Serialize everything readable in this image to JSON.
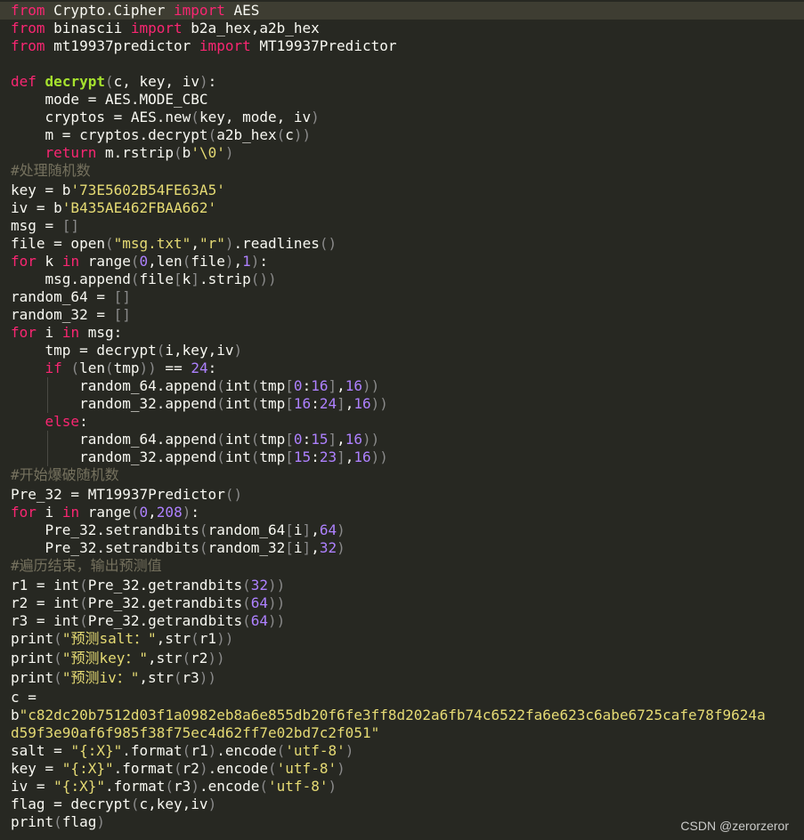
{
  "editor": {
    "lines": [
      [
        [
          "kw",
          "from"
        ],
        [
          "plain",
          " Crypto.Cipher "
        ],
        [
          "kw",
          "import"
        ],
        [
          "plain",
          " AES"
        ]
      ],
      [
        [
          "kw",
          "from"
        ],
        [
          "plain",
          " binascii "
        ],
        [
          "kw",
          "import"
        ],
        [
          "plain",
          " b2a_hex,a2b_hex"
        ]
      ],
      [
        [
          "kw",
          "from"
        ],
        [
          "plain",
          " mt19937predictor "
        ],
        [
          "kw",
          "import"
        ],
        [
          "plain",
          " MT19937Predictor"
        ]
      ],
      [],
      [
        [
          "kw",
          "def"
        ],
        [
          "plain",
          " "
        ],
        [
          "fn",
          "decrypt"
        ],
        [
          "br",
          "("
        ],
        [
          "plain",
          "c, key, iv"
        ],
        [
          "br",
          ")"
        ],
        [
          "plain",
          ":"
        ]
      ],
      [
        [
          "plain",
          "    mode = AES.MODE_CBC"
        ]
      ],
      [
        [
          "plain",
          "    cryptos = AES.new"
        ],
        [
          "br",
          "("
        ],
        [
          "plain",
          "key, mode, iv"
        ],
        [
          "br",
          ")"
        ]
      ],
      [
        [
          "plain",
          "    m = cryptos.decrypt"
        ],
        [
          "br",
          "("
        ],
        [
          "plain",
          "a2b_hex"
        ],
        [
          "br",
          "("
        ],
        [
          "plain",
          "c"
        ],
        [
          "br",
          "))"
        ]
      ],
      [
        [
          "plain",
          "    "
        ],
        [
          "kw",
          "return"
        ],
        [
          "plain",
          " m.rstrip"
        ],
        [
          "br",
          "("
        ],
        [
          "plain",
          "b"
        ],
        [
          "str",
          "'\\0'"
        ],
        [
          "br",
          ")"
        ]
      ],
      [
        [
          "cmt",
          "#处理随机数"
        ]
      ],
      [
        [
          "plain",
          "key = b"
        ],
        [
          "str",
          "'73E5602B54FE63A5'"
        ]
      ],
      [
        [
          "plain",
          "iv = b"
        ],
        [
          "str",
          "'B435AE462FBAA662'"
        ]
      ],
      [
        [
          "plain",
          "msg = "
        ],
        [
          "br",
          "[]"
        ]
      ],
      [
        [
          "plain",
          "file = open"
        ],
        [
          "br",
          "("
        ],
        [
          "str",
          "\"msg.txt\""
        ],
        [
          "plain",
          ","
        ],
        [
          "str",
          "\"r\""
        ],
        [
          "br",
          ")"
        ],
        [
          "plain",
          ".readlines"
        ],
        [
          "br",
          "()"
        ]
      ],
      [
        [
          "kw",
          "for"
        ],
        [
          "plain",
          " k "
        ],
        [
          "kw",
          "in"
        ],
        [
          "plain",
          " range"
        ],
        [
          "br",
          "("
        ],
        [
          "num",
          "0"
        ],
        [
          "plain",
          ",len"
        ],
        [
          "br",
          "("
        ],
        [
          "plain",
          "file"
        ],
        [
          "br",
          ")"
        ],
        [
          "plain",
          ","
        ],
        [
          "num",
          "1"
        ],
        [
          "br",
          ")"
        ],
        [
          "plain",
          ":"
        ]
      ],
      [
        [
          "plain",
          "    msg.append"
        ],
        [
          "br",
          "("
        ],
        [
          "plain",
          "file"
        ],
        [
          "br",
          "["
        ],
        [
          "plain",
          "k"
        ],
        [
          "br",
          "]"
        ],
        [
          "plain",
          ".strip"
        ],
        [
          "br",
          "())"
        ]
      ],
      [
        [
          "plain",
          "random_64 = "
        ],
        [
          "br",
          "[]"
        ]
      ],
      [
        [
          "plain",
          "random_32 = "
        ],
        [
          "br",
          "[]"
        ]
      ],
      [
        [
          "kw",
          "for"
        ],
        [
          "plain",
          " i "
        ],
        [
          "kw",
          "in"
        ],
        [
          "plain",
          " msg:"
        ]
      ],
      [
        [
          "plain",
          "    tmp = decrypt"
        ],
        [
          "br",
          "("
        ],
        [
          "plain",
          "i,key,iv"
        ],
        [
          "br",
          ")"
        ]
      ],
      [
        [
          "plain",
          "    "
        ],
        [
          "kw",
          "if"
        ],
        [
          "plain",
          " "
        ],
        [
          "br",
          "("
        ],
        [
          "plain",
          "len"
        ],
        [
          "br",
          "("
        ],
        [
          "plain",
          "tmp"
        ],
        [
          "br",
          "))"
        ],
        [
          "plain",
          " == "
        ],
        [
          "num",
          "24"
        ],
        [
          "plain",
          ":"
        ]
      ],
      [
        [
          "plain",
          "        random_64.append"
        ],
        [
          "br",
          "("
        ],
        [
          "plain",
          "int"
        ],
        [
          "br",
          "("
        ],
        [
          "plain",
          "tmp"
        ],
        [
          "br",
          "["
        ],
        [
          "num",
          "0"
        ],
        [
          "plain",
          ":"
        ],
        [
          "num",
          "16"
        ],
        [
          "br",
          "]"
        ],
        [
          "plain",
          ","
        ],
        [
          "num",
          "16"
        ],
        [
          "br",
          "))"
        ]
      ],
      [
        [
          "plain",
          "        random_32.append"
        ],
        [
          "br",
          "("
        ],
        [
          "plain",
          "int"
        ],
        [
          "br",
          "("
        ],
        [
          "plain",
          "tmp"
        ],
        [
          "br",
          "["
        ],
        [
          "num",
          "16"
        ],
        [
          "plain",
          ":"
        ],
        [
          "num",
          "24"
        ],
        [
          "br",
          "]"
        ],
        [
          "plain",
          ","
        ],
        [
          "num",
          "16"
        ],
        [
          "br",
          "))"
        ]
      ],
      [
        [
          "plain",
          "    "
        ],
        [
          "kw",
          "else"
        ],
        [
          "plain",
          ":"
        ]
      ],
      [
        [
          "plain",
          "        random_64.append"
        ],
        [
          "br",
          "("
        ],
        [
          "plain",
          "int"
        ],
        [
          "br",
          "("
        ],
        [
          "plain",
          "tmp"
        ],
        [
          "br",
          "["
        ],
        [
          "num",
          "0"
        ],
        [
          "plain",
          ":"
        ],
        [
          "num",
          "15"
        ],
        [
          "br",
          "]"
        ],
        [
          "plain",
          ","
        ],
        [
          "num",
          "16"
        ],
        [
          "br",
          "))"
        ]
      ],
      [
        [
          "plain",
          "        random_32.append"
        ],
        [
          "br",
          "("
        ],
        [
          "plain",
          "int"
        ],
        [
          "br",
          "("
        ],
        [
          "plain",
          "tmp"
        ],
        [
          "br",
          "["
        ],
        [
          "num",
          "15"
        ],
        [
          "plain",
          ":"
        ],
        [
          "num",
          "23"
        ],
        [
          "br",
          "]"
        ],
        [
          "plain",
          ","
        ],
        [
          "num",
          "16"
        ],
        [
          "br",
          "))"
        ]
      ],
      [
        [
          "cmt",
          "#开始爆破随机数"
        ]
      ],
      [
        [
          "plain",
          "Pre_32 = MT19937Predictor"
        ],
        [
          "br",
          "()"
        ]
      ],
      [
        [
          "kw",
          "for"
        ],
        [
          "plain",
          " i "
        ],
        [
          "kw",
          "in"
        ],
        [
          "plain",
          " range"
        ],
        [
          "br",
          "("
        ],
        [
          "num",
          "0"
        ],
        [
          "plain",
          ","
        ],
        [
          "num",
          "208"
        ],
        [
          "br",
          ")"
        ],
        [
          "plain",
          ":"
        ]
      ],
      [
        [
          "plain",
          "    Pre_32.setrandbits"
        ],
        [
          "br",
          "("
        ],
        [
          "plain",
          "random_64"
        ],
        [
          "br",
          "["
        ],
        [
          "plain",
          "i"
        ],
        [
          "br",
          "]"
        ],
        [
          "plain",
          ","
        ],
        [
          "num",
          "64"
        ],
        [
          "br",
          ")"
        ]
      ],
      [
        [
          "plain",
          "    Pre_32.setrandbits"
        ],
        [
          "br",
          "("
        ],
        [
          "plain",
          "random_32"
        ],
        [
          "br",
          "["
        ],
        [
          "plain",
          "i"
        ],
        [
          "br",
          "]"
        ],
        [
          "plain",
          ","
        ],
        [
          "num",
          "32"
        ],
        [
          "br",
          ")"
        ]
      ],
      [
        [
          "cmt",
          "#遍历结束，输出预测值"
        ]
      ],
      [
        [
          "plain",
          "r1 = int"
        ],
        [
          "br",
          "("
        ],
        [
          "plain",
          "Pre_32.getrandbits"
        ],
        [
          "br",
          "("
        ],
        [
          "num",
          "32"
        ],
        [
          "br",
          "))"
        ]
      ],
      [
        [
          "plain",
          "r2 = int"
        ],
        [
          "br",
          "("
        ],
        [
          "plain",
          "Pre_32.getrandbits"
        ],
        [
          "br",
          "("
        ],
        [
          "num",
          "64"
        ],
        [
          "br",
          "))"
        ]
      ],
      [
        [
          "plain",
          "r3 = int"
        ],
        [
          "br",
          "("
        ],
        [
          "plain",
          "Pre_32.getrandbits"
        ],
        [
          "br",
          "("
        ],
        [
          "num",
          "64"
        ],
        [
          "br",
          "))"
        ]
      ],
      [
        [
          "plain",
          "print"
        ],
        [
          "br",
          "("
        ],
        [
          "str",
          "\"预测salt：\""
        ],
        [
          "plain",
          ",str"
        ],
        [
          "br",
          "("
        ],
        [
          "plain",
          "r1"
        ],
        [
          "br",
          "))"
        ]
      ],
      [
        [
          "plain",
          "print"
        ],
        [
          "br",
          "("
        ],
        [
          "str",
          "\"预测key：\""
        ],
        [
          "plain",
          ",str"
        ],
        [
          "br",
          "("
        ],
        [
          "plain",
          "r2"
        ],
        [
          "br",
          "))"
        ]
      ],
      [
        [
          "plain",
          "print"
        ],
        [
          "br",
          "("
        ],
        [
          "str",
          "\"预测iv：\""
        ],
        [
          "plain",
          ",str"
        ],
        [
          "br",
          "("
        ],
        [
          "plain",
          "r3"
        ],
        [
          "br",
          "))"
        ]
      ],
      [
        [
          "plain",
          "c ="
        ]
      ],
      [
        [
          "plain",
          "b"
        ],
        [
          "str",
          "\"c82dc20b7512d03f1a0982eb8a6e855db20f6fe3ff8d202a6fb74c6522fa6e623c6abe6725cafe78f9624a"
        ]
      ],
      [
        [
          "str",
          "d59f3e90af6f985f38f75ec4d62ff7e02bd7c2f051\""
        ]
      ],
      [
        [
          "plain",
          "salt = "
        ],
        [
          "str",
          "\"{:X}\""
        ],
        [
          "plain",
          ".format"
        ],
        [
          "br",
          "("
        ],
        [
          "plain",
          "r1"
        ],
        [
          "br",
          ")"
        ],
        [
          "plain",
          ".encode"
        ],
        [
          "br",
          "("
        ],
        [
          "str",
          "'utf-8'"
        ],
        [
          "br",
          ")"
        ]
      ],
      [
        [
          "plain",
          "key = "
        ],
        [
          "str",
          "\"{:X}\""
        ],
        [
          "plain",
          ".format"
        ],
        [
          "br",
          "("
        ],
        [
          "plain",
          "r2"
        ],
        [
          "br",
          ")"
        ],
        [
          "plain",
          ".encode"
        ],
        [
          "br",
          "("
        ],
        [
          "str",
          "'utf-8'"
        ],
        [
          "br",
          ")"
        ]
      ],
      [
        [
          "plain",
          "iv = "
        ],
        [
          "str",
          "\"{:X}\""
        ],
        [
          "plain",
          ".format"
        ],
        [
          "br",
          "("
        ],
        [
          "plain",
          "r3"
        ],
        [
          "br",
          ")"
        ],
        [
          "plain",
          ".encode"
        ],
        [
          "br",
          "("
        ],
        [
          "str",
          "'utf-8'"
        ],
        [
          "br",
          ")"
        ]
      ],
      [
        [
          "plain",
          "flag = decrypt"
        ],
        [
          "br",
          "("
        ],
        [
          "plain",
          "c,key,iv"
        ],
        [
          "br",
          ")"
        ]
      ],
      [
        [
          "plain",
          "print"
        ],
        [
          "br",
          "("
        ],
        [
          "plain",
          "flag"
        ],
        [
          "br",
          ")"
        ]
      ]
    ]
  },
  "watermark": {
    "text": "CSDN @zerorzeror"
  }
}
